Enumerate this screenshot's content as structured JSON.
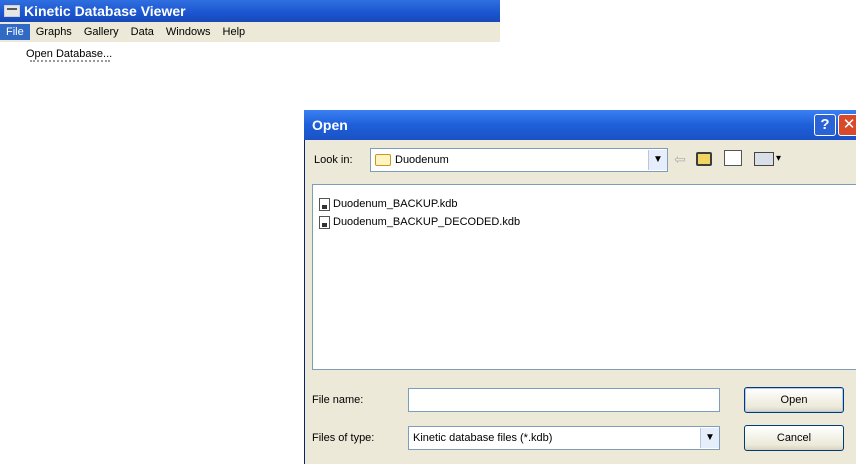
{
  "app": {
    "title": "Kinetic Database Viewer",
    "menu": [
      "File",
      "Graphs",
      "Gallery",
      "Data",
      "Windows",
      "Help"
    ],
    "active_menu_index": 0,
    "file_menu": {
      "items": [
        "Open Database..."
      ]
    }
  },
  "dialog": {
    "title": "Open",
    "help_label": "?",
    "close_label": "✕",
    "look_in_label": "Look in:",
    "look_in_value": "Duodenum",
    "files": [
      "Duodenum_BACKUP.kdb",
      "Duodenum_BACKUP_DECODED.kdb"
    ],
    "file_name_label": "File name:",
    "file_name_value": "",
    "file_type_label": "Files of type:",
    "file_type_value": "Kinetic database files (*.kdb)",
    "open_label": "Open",
    "cancel_label": "Cancel"
  },
  "colors": {
    "titlebar": "#1b55cf",
    "menu_highlight": "#316ac5",
    "dialog_bg": "#ece9d8",
    "close_button": "#d84a2a"
  },
  "icons": {
    "app": "app-window-icon",
    "folder": "folder-icon",
    "back": "back-arrow-icon",
    "up": "up-folder-icon",
    "new_folder": "new-folder-icon",
    "views": "views-menu-icon",
    "file": "file-icon"
  }
}
